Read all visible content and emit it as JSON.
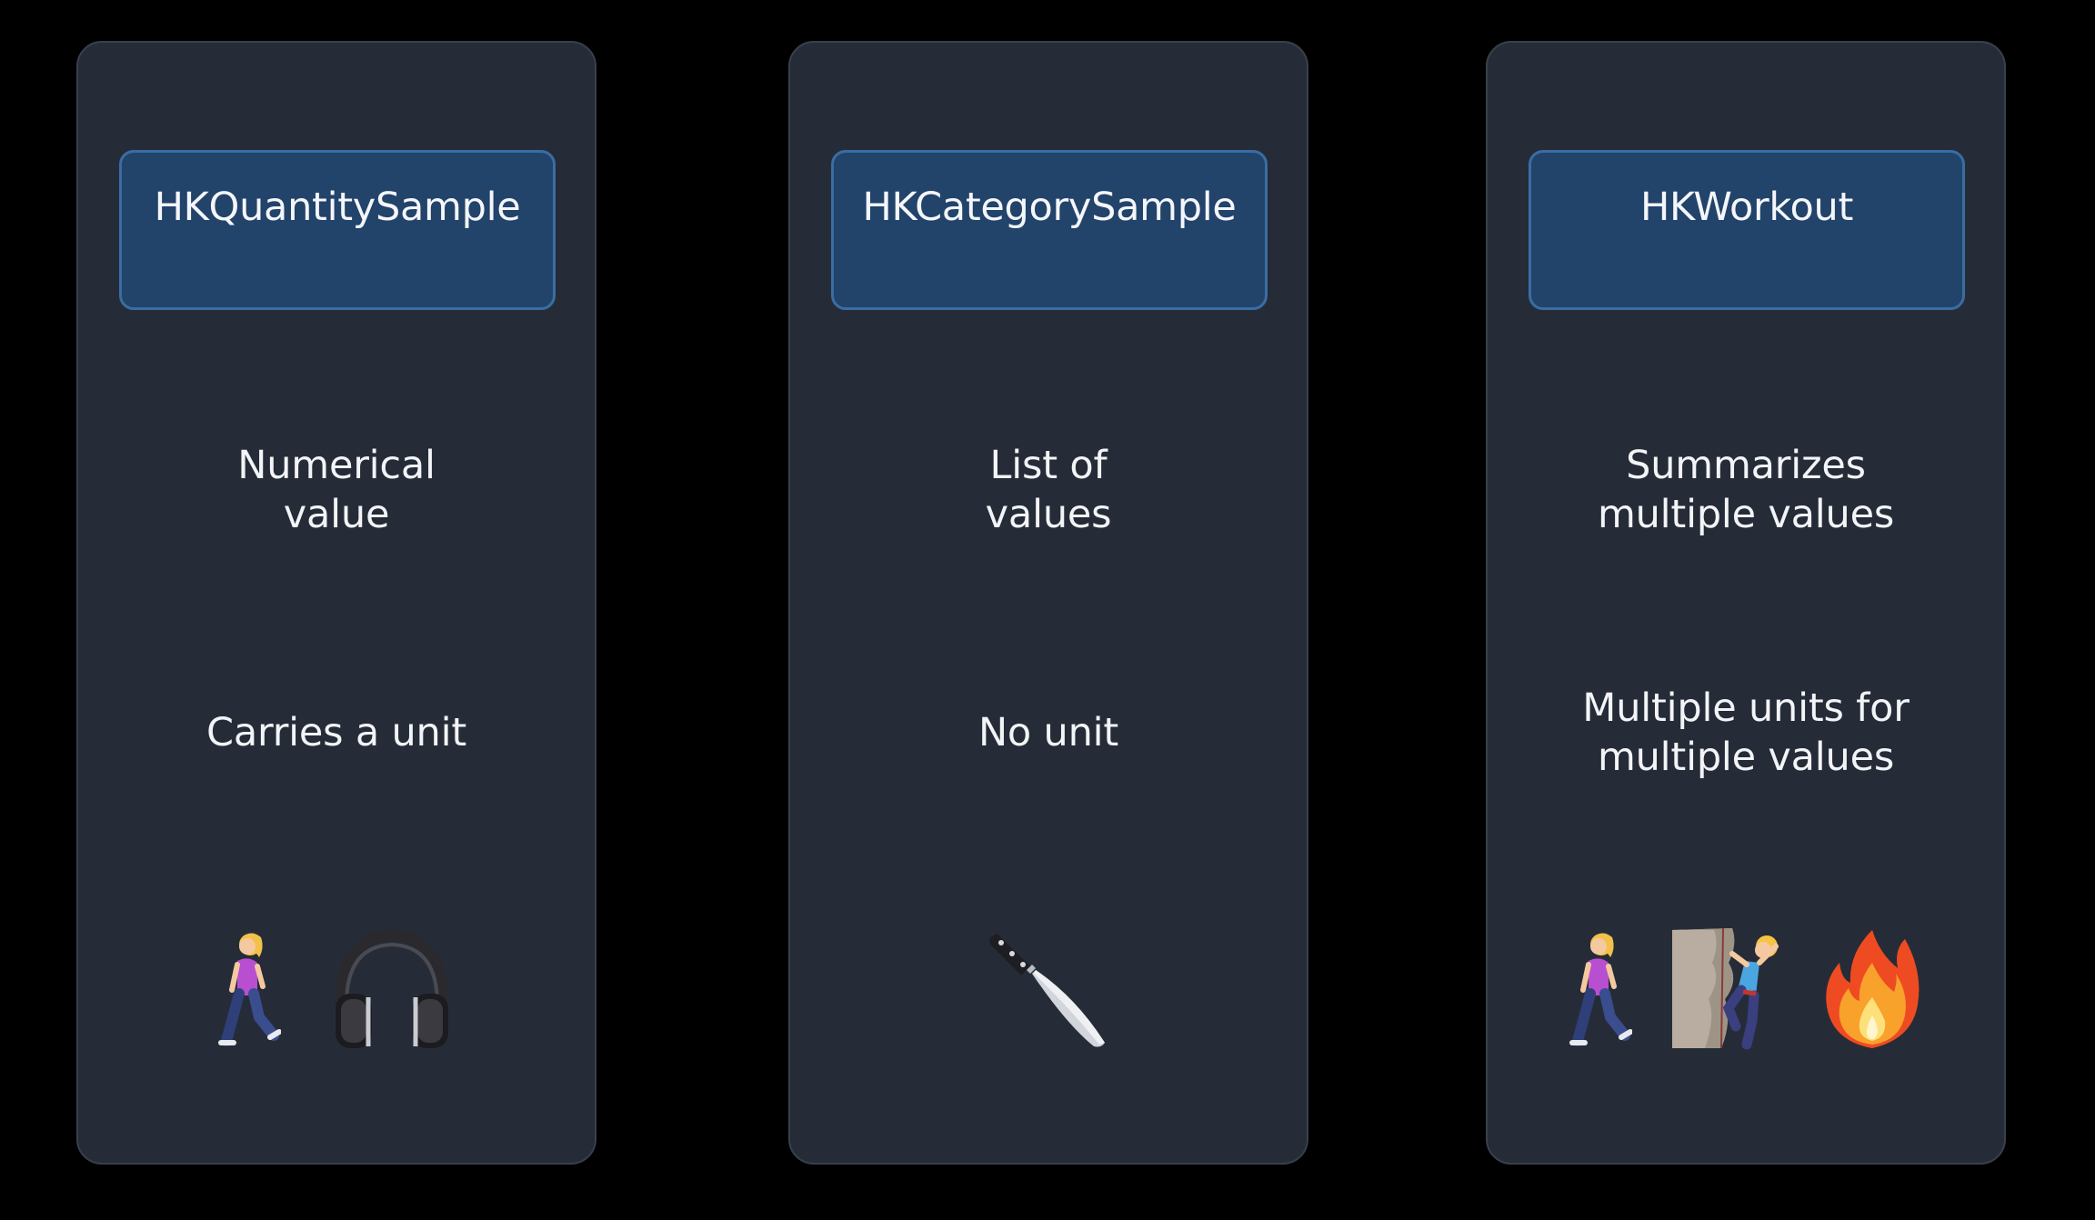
{
  "panels": [
    {
      "title": "HKQuantitySample",
      "desc1": [
        "Numerical",
        "value"
      ],
      "desc2": [
        "Carries a unit"
      ],
      "icons": [
        "person-walking-icon",
        "headphones-icon"
      ]
    },
    {
      "title": "HKCategorySample",
      "desc1": [
        "List of",
        "values"
      ],
      "desc2": [
        "No unit"
      ],
      "icons": [
        "knife-icon"
      ]
    },
    {
      "title": "HKWorkout",
      "desc1": [
        "Summarizes",
        "multiple values"
      ],
      "desc2": [
        "Multiple units for",
        "multiple values"
      ],
      "icons": [
        "person-walking-icon",
        "person-climbing-icon",
        "fire-icon"
      ]
    }
  ],
  "colors": {
    "background": "#000000",
    "panel": "#262c37",
    "type_box": "#22436a",
    "type_box_border": "#3a6da4",
    "text": "#f2f4f7"
  }
}
